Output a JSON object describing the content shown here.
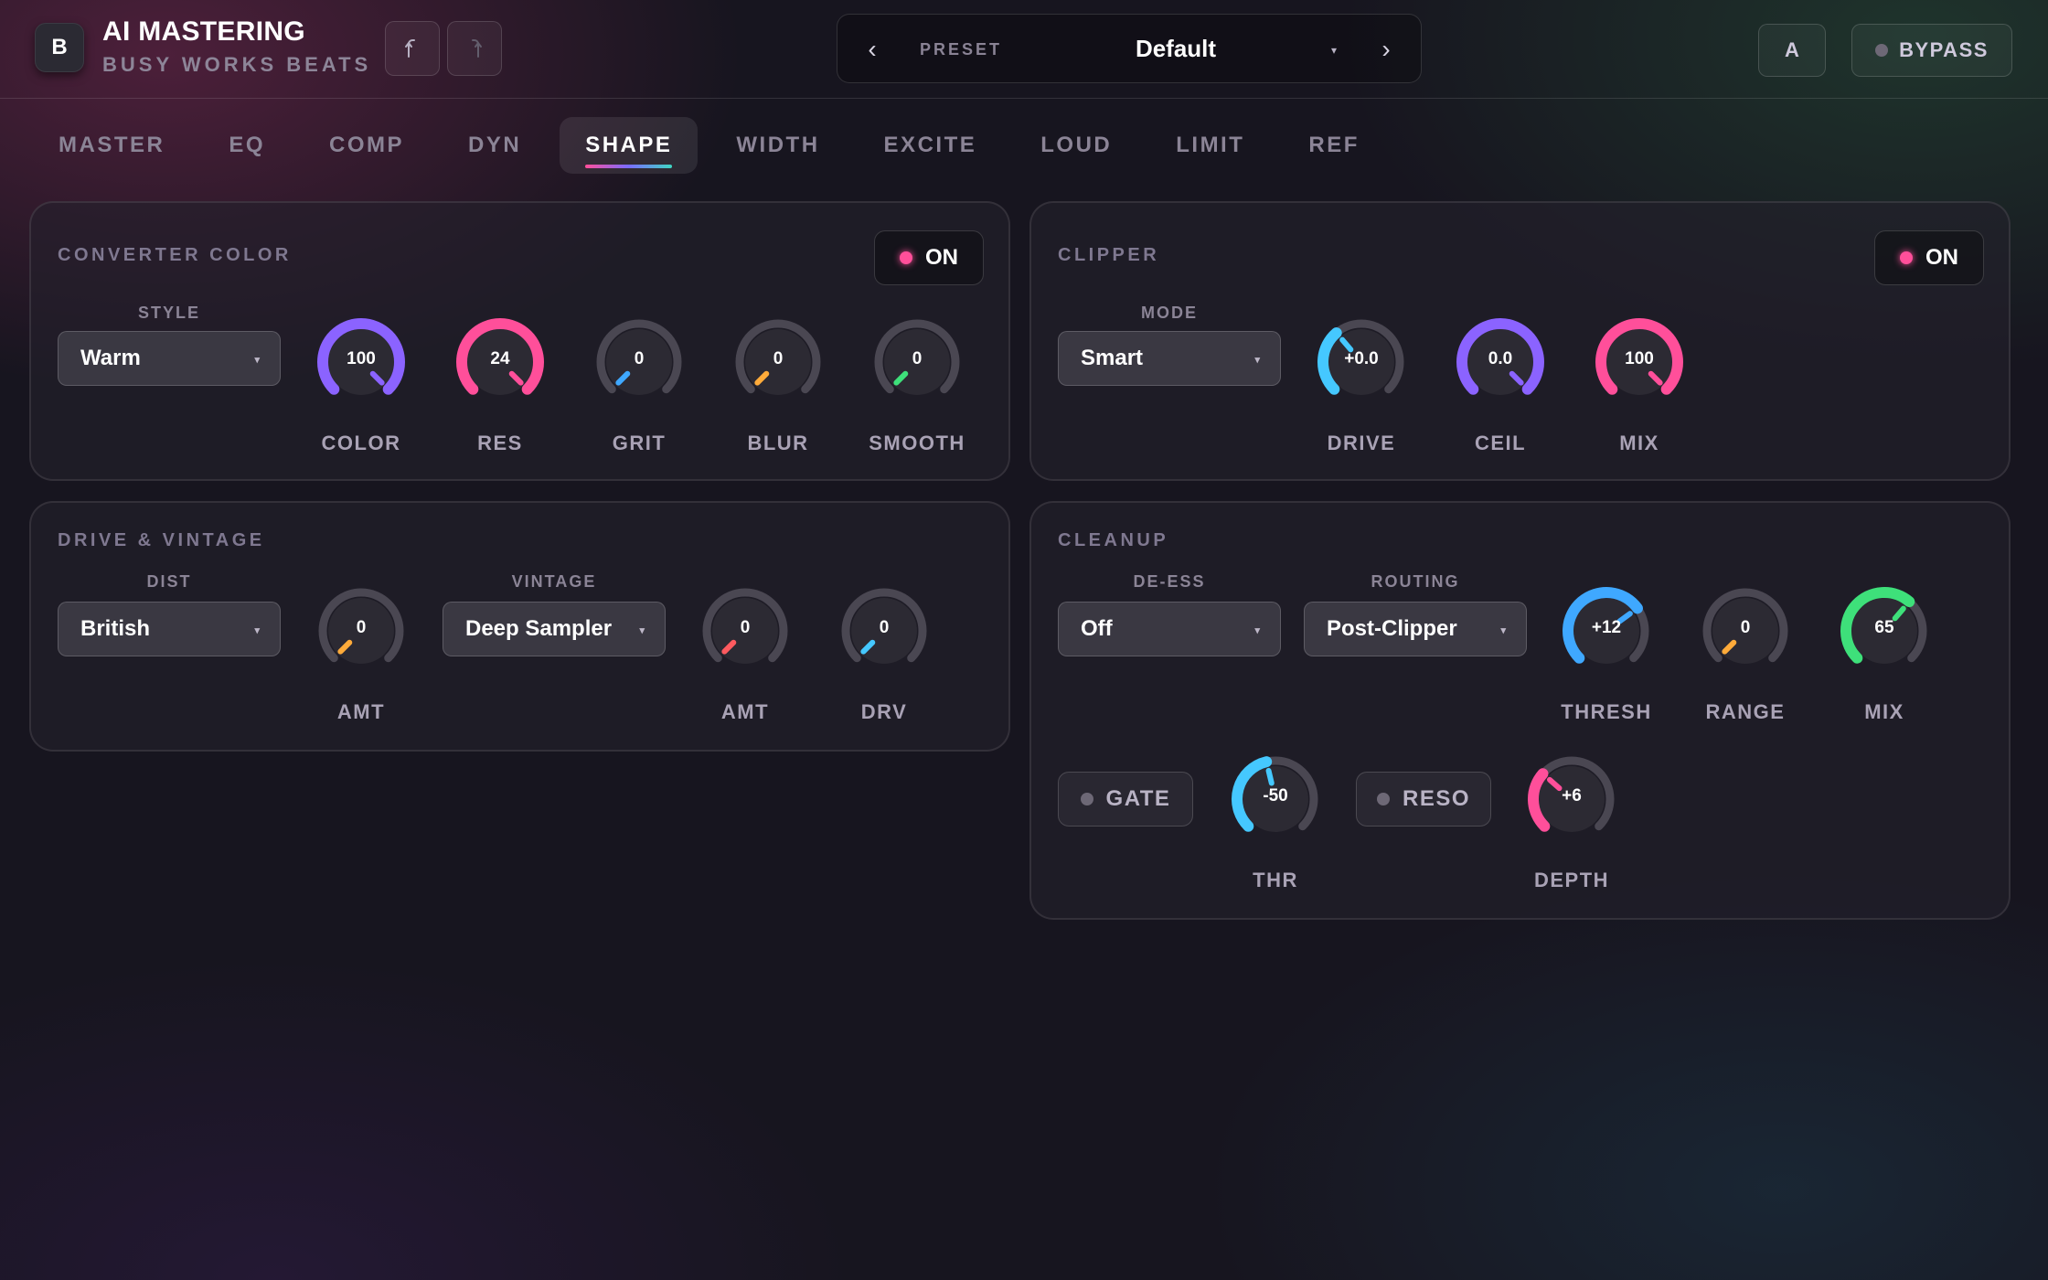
{
  "header": {
    "logo_letter": "B",
    "title": "AI MASTERING",
    "subtitle": "BUSY WORKS BEATS",
    "undo_icon": "undo-icon",
    "redo_icon": "redo-icon",
    "preset": {
      "label": "PRESET",
      "name": "Default",
      "prev": "‹",
      "next": "›",
      "caret": "▾"
    },
    "ab_label": "A",
    "bypass_label": "BYPASS"
  },
  "tabs": [
    {
      "label": "MASTER"
    },
    {
      "label": "EQ"
    },
    {
      "label": "COMP"
    },
    {
      "label": "DYN"
    },
    {
      "label": "SHAPE",
      "active": true
    },
    {
      "label": "WIDTH"
    },
    {
      "label": "EXCITE"
    },
    {
      "label": "LOUD"
    },
    {
      "label": "LIMIT"
    },
    {
      "label": "REF"
    }
  ],
  "colors": {
    "purple": "#8b63ff",
    "pink": "#ff4f9a",
    "blue": "#3fa8ff",
    "orange": "#ffab3a",
    "green": "#3ee07a",
    "red": "#ff5a5f",
    "cyan": "#45c8ff",
    "track": "#4a4752",
    "knob_face": "#2c2a33"
  },
  "converter_color": {
    "title": "CONVERTER COLOR",
    "toggle_label": "ON",
    "style_label": "STYLE",
    "style_value": "Warm",
    "knobs": [
      {
        "label": "COLOR",
        "value": "100",
        "fraction": 1.0,
        "color": "#8b63ff"
      },
      {
        "label": "RES",
        "value": "24",
        "fraction": 1.0,
        "color": "#ff4f9a"
      },
      {
        "label": "GRIT",
        "value": "0",
        "fraction": 0.0,
        "color": "#3fa8ff"
      },
      {
        "label": "BLUR",
        "value": "0",
        "fraction": 0.0,
        "color": "#ffab3a"
      },
      {
        "label": "SMOOTH",
        "value": "0",
        "fraction": 0.0,
        "color": "#3ee07a"
      }
    ]
  },
  "clipper": {
    "title": "CLIPPER",
    "toggle_label": "ON",
    "mode_label": "MODE",
    "mode_value": "Smart",
    "knobs": [
      {
        "label": "DRIVE",
        "value": "+0.0",
        "fraction": 0.35,
        "color": "#45c8ff"
      },
      {
        "label": "CEIL",
        "value": "0.0",
        "fraction": 1.0,
        "color": "#8b63ff"
      },
      {
        "label": "MIX",
        "value": "100",
        "fraction": 1.0,
        "color": "#ff4f9a"
      }
    ]
  },
  "drive_vintage": {
    "title": "DRIVE & VINTAGE",
    "dist_label": "DIST",
    "dist_value": "British",
    "vintage_label": "VINTAGE",
    "vintage_value": "Deep Sampler",
    "knobs": [
      {
        "label": "AMT",
        "value": "0",
        "fraction": 0.0,
        "color": "#ffab3a"
      },
      {
        "label": "AMT",
        "value": "0",
        "fraction": 0.0,
        "color": "#ff5a5f"
      },
      {
        "label": "DRV",
        "value": "0",
        "fraction": 0.0,
        "color": "#45c8ff"
      }
    ]
  },
  "cleanup": {
    "title": "CLEANUP",
    "deess_label": "DE-ESS",
    "deess_value": "Off",
    "routing_label": "ROUTING",
    "routing_value": "Post-Clipper",
    "knobs": [
      {
        "label": "THRESH",
        "value": "+12",
        "fraction": 0.7,
        "color": "#3fa8ff"
      },
      {
        "label": "RANGE",
        "value": "0",
        "fraction": 0.0,
        "color": "#ffab3a"
      },
      {
        "label": "MIX",
        "value": "65",
        "fraction": 0.65,
        "color": "#3ee07a"
      }
    ],
    "gate_label": "GATE",
    "reso_label": "RESO",
    "lower_knobs": [
      {
        "label": "THR",
        "value": "-50",
        "fraction": 0.45,
        "color": "#45c8ff"
      },
      {
        "label": "DEPTH",
        "value": "+6",
        "fraction": 0.32,
        "color": "#ff4f9a"
      }
    ]
  }
}
